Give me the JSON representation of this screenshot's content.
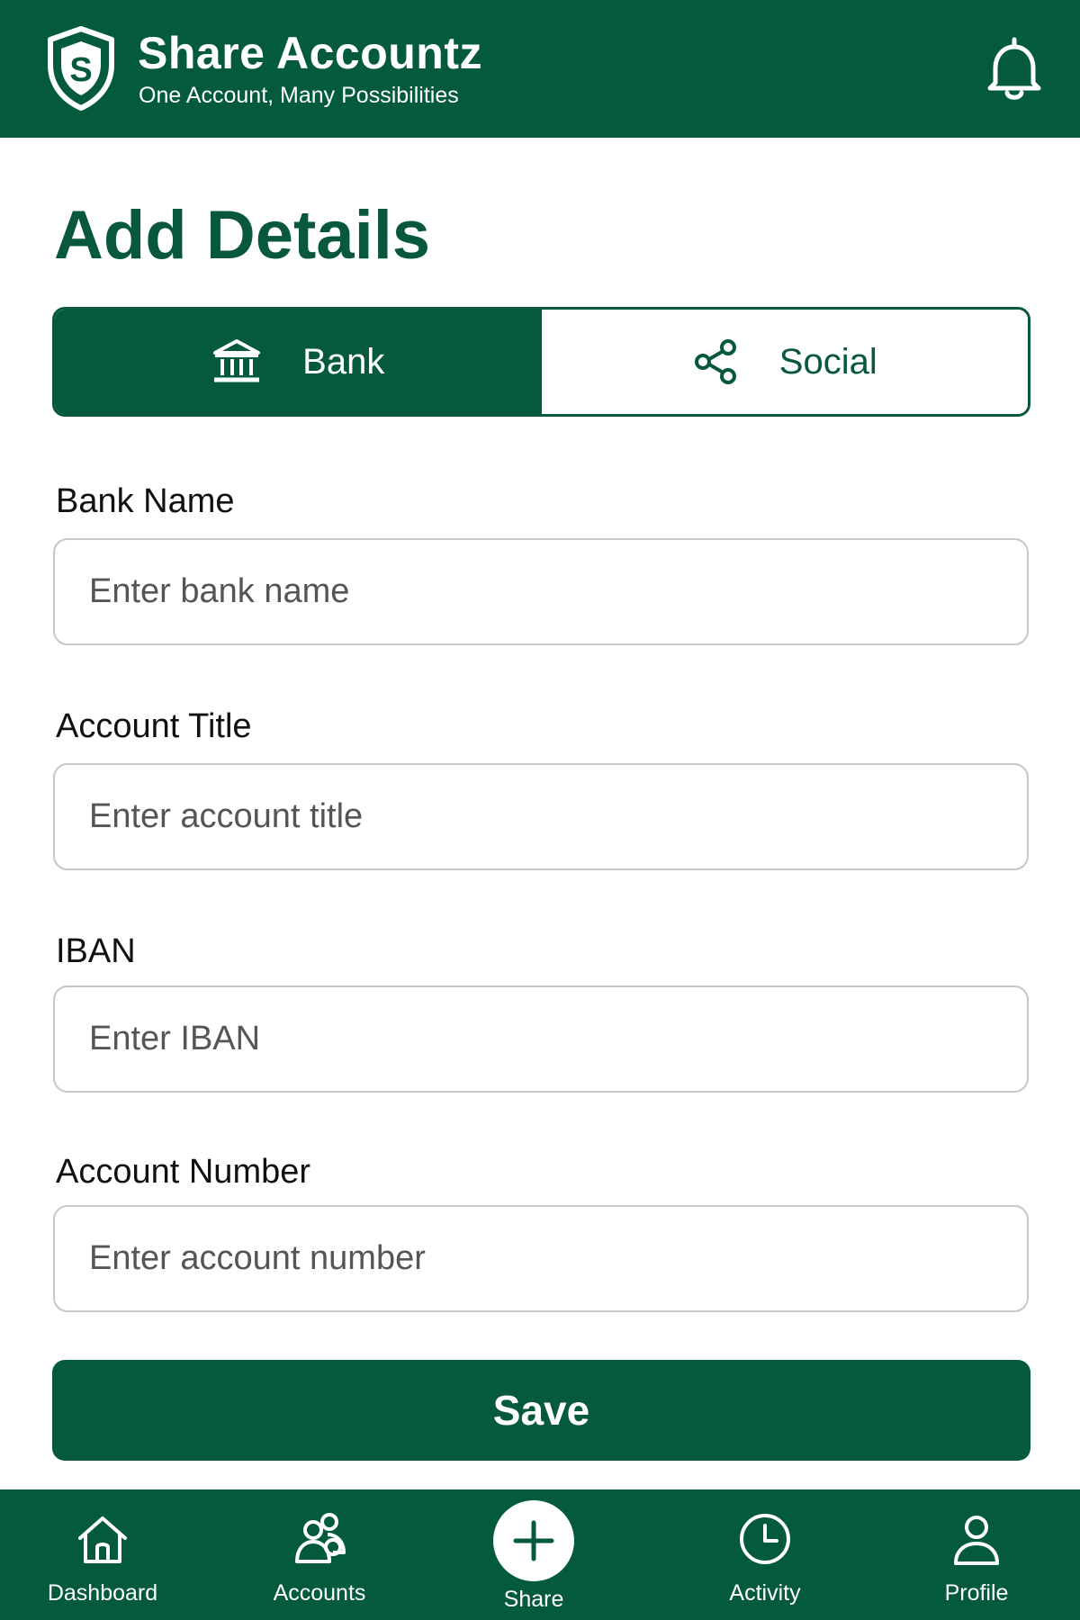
{
  "header": {
    "title": "Share Accountz",
    "tagline": "One Account, Many Possibilities",
    "logo_icon": "shield-s-logo",
    "notification_icon": "bell-icon"
  },
  "page": {
    "title": "Add Details"
  },
  "tabs": [
    {
      "label": "Bank",
      "icon": "bank-icon",
      "active": true
    },
    {
      "label": "Social",
      "icon": "share-icon",
      "active": false
    }
  ],
  "form": {
    "bank_name": {
      "label": "Bank Name",
      "placeholder": "Enter bank name",
      "value": ""
    },
    "account_title": {
      "label": "Account Title",
      "placeholder": "Enter account title",
      "value": ""
    },
    "iban": {
      "label": "IBAN",
      "placeholder": "Enter IBAN",
      "value": ""
    },
    "account_number": {
      "label": "Account Number",
      "placeholder": "Enter account number",
      "value": ""
    },
    "save_label": "Save"
  },
  "bottom_nav": [
    {
      "label": "Dashboard",
      "icon": "home-icon"
    },
    {
      "label": "Accounts",
      "icon": "users-icon"
    },
    {
      "label": "Share",
      "icon": "plus-icon"
    },
    {
      "label": "Activity",
      "icon": "clock-icon"
    },
    {
      "label": "Profile",
      "icon": "user-icon"
    }
  ],
  "colors": {
    "primary": "#045a3e",
    "background": "#ffffff",
    "input_border": "#c7c7c7"
  }
}
